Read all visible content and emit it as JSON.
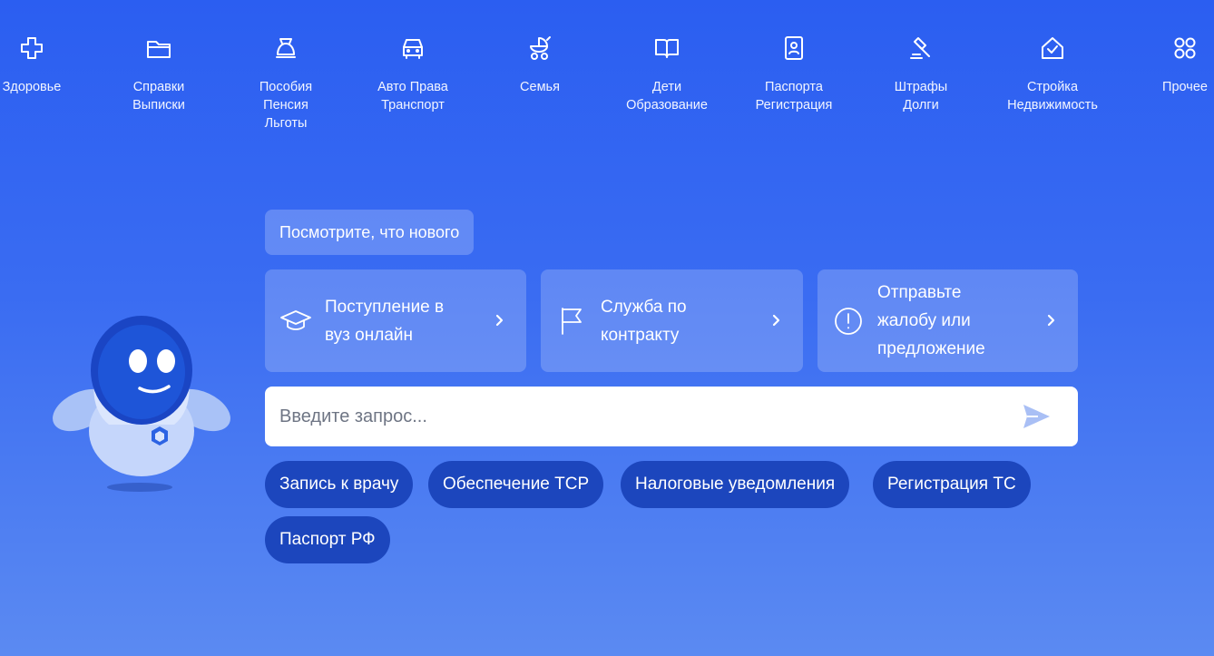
{
  "categories": [
    {
      "icon": "plus-icon",
      "label": "Здоровье"
    },
    {
      "icon": "folder-icon",
      "label": "Справки\nВыписки"
    },
    {
      "icon": "piggy-bank-icon",
      "label": "Пособия\nПенсия\nЛьготы"
    },
    {
      "icon": "car-icon",
      "label": "Авто Права\nТранспорт"
    },
    {
      "icon": "stroller-icon",
      "label": "Семья"
    },
    {
      "icon": "book-icon",
      "label": "Дети\nОбразование"
    },
    {
      "icon": "passport-icon",
      "label": "Паспорта\nРегистрация"
    },
    {
      "icon": "gavel-icon",
      "label": "Штрафы\nДолги"
    },
    {
      "icon": "house-check-icon",
      "label": "Стройка\nНедвижимость"
    },
    {
      "icon": "grid-icon",
      "label": "Прочее"
    }
  ],
  "news_button": "Посмотрите, что нового",
  "cards": [
    {
      "icon": "graduation-cap-icon",
      "text": "Поступление в\nвуз онлайн"
    },
    {
      "icon": "flag-icon",
      "text": "Служба по\nконтракту"
    },
    {
      "icon": "exclamation-circle-icon",
      "text": "Отправьте\nжалобу или\nпредложение"
    }
  ],
  "search": {
    "placeholder": "Введите запрос..."
  },
  "chips": [
    "Запись к врачу",
    "Обеспечение ТСР",
    "Налоговые уведомления",
    "Регистрация ТС",
    "Паспорт РФ"
  ],
  "colors": {
    "background": "#2b5ef1",
    "chip": "#1c46bd",
    "send_icon": "#a9bff5"
  }
}
